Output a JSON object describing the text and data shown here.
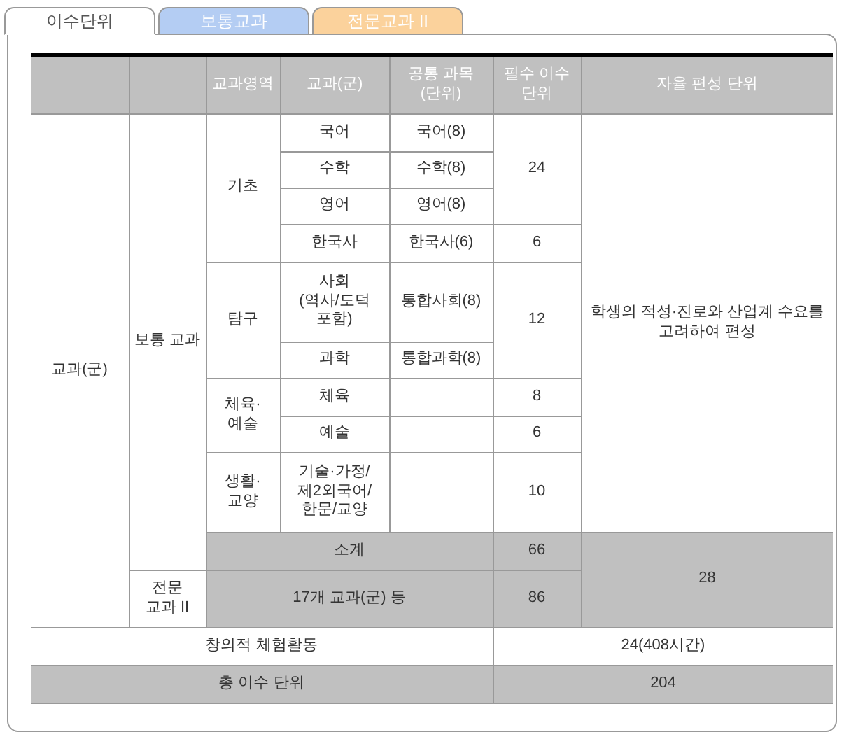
{
  "tabs": [
    {
      "label": "이수단위",
      "selected": true,
      "color": "#ffffff"
    },
    {
      "label": "보통교과",
      "selected": false,
      "color": "#b4cdf3"
    },
    {
      "label": "전문교과 II",
      "selected": false,
      "color": "#fbd29c"
    }
  ],
  "table": {
    "rows": [
      {
        "kind": "header",
        "cells": [
          {
            "shaded": true
          },
          {
            "shaded": true
          },
          {
            "text": "교과영역",
            "shaded": true
          },
          {
            "text": "교과(군)",
            "shaded": true
          },
          {
            "text": "공통 과목\n(단위)",
            "shaded": true
          },
          {
            "text": "필수 이수\n단위",
            "shaded": true
          },
          {
            "text": "자율 편성 단위",
            "shaded": true
          }
        ]
      },
      {
        "kind": "body",
        "cells": [
          {
            "text": "교과(군)",
            "rowspan": 11,
            "shaded": false
          },
          {
            "text": "보통 교과",
            "rowspan": 10,
            "shaded": false
          },
          {
            "text": "기초",
            "rowspan": 4,
            "shaded": false
          },
          {
            "text": "국어",
            "shaded": false
          },
          {
            "text": "국어(8)",
            "shaded": false
          },
          {
            "text": "24",
            "rowspan": 3,
            "shaded": false
          },
          {
            "text": "학생의 적성·진로와 산업계 수요를\n고려하여 편성",
            "rowspan": 9,
            "shaded": false
          }
        ]
      },
      {
        "kind": "body",
        "cells": [
          {
            "text": "수학",
            "shaded": false
          },
          {
            "text": "수학(8)",
            "shaded": false
          }
        ]
      },
      {
        "kind": "body",
        "cells": [
          {
            "text": "영어",
            "shaded": false
          },
          {
            "text": "영어(8)",
            "shaded": false
          }
        ]
      },
      {
        "kind": "body",
        "cells": [
          {
            "text": "한국사",
            "shaded": false
          },
          {
            "text": "한국사(6)",
            "shaded": false
          },
          {
            "text": "6",
            "shaded": false
          }
        ]
      },
      {
        "kind": "body",
        "cells": [
          {
            "text": "탐구",
            "rowspan": 2,
            "shaded": false
          },
          {
            "text": "사회\n(역사/도덕\n포함)",
            "shaded": false
          },
          {
            "text": "통합사회(8)",
            "shaded": false
          },
          {
            "text": "12",
            "rowspan": 2,
            "shaded": false
          }
        ]
      },
      {
        "kind": "body",
        "cells": [
          {
            "text": "과학",
            "shaded": false
          },
          {
            "text": "통합과학(8)",
            "shaded": false
          }
        ]
      },
      {
        "kind": "body",
        "cells": [
          {
            "text": "체육·\n예술",
            "rowspan": 2,
            "shaded": false
          },
          {
            "text": "체육",
            "shaded": false
          },
          {
            "shaded": false
          },
          {
            "text": "8",
            "shaded": false
          }
        ]
      },
      {
        "kind": "body",
        "cells": [
          {
            "text": "예술",
            "shaded": false
          },
          {
            "shaded": false
          },
          {
            "text": "6",
            "shaded": false
          }
        ]
      },
      {
        "kind": "body",
        "cells": [
          {
            "text": "생활·\n교양",
            "shaded": false
          },
          {
            "text": "기술·가정/\n제2외국어/\n한문/교양",
            "shaded": false
          },
          {
            "shaded": false
          },
          {
            "text": "10",
            "shaded": false
          }
        ]
      },
      {
        "kind": "body",
        "cells": [
          {
            "text": "소계",
            "colspan": 3,
            "shaded": true
          },
          {
            "text": "66",
            "shaded": true
          },
          {
            "text": "28",
            "rowspan": 2,
            "shaded": true
          }
        ]
      },
      {
        "kind": "body",
        "cells": [
          {
            "text": "전문\n교과 II",
            "shaded": false
          },
          {
            "text": "17개 교과(군) 등",
            "colspan": 3,
            "shaded": true
          },
          {
            "text": "86",
            "shaded": true
          }
        ]
      },
      {
        "kind": "body",
        "cells": [
          {
            "text": "창의적 체험활동",
            "colspan": 5,
            "shaded": false
          },
          {
            "text": "24(408시간)",
            "colspan": 2,
            "shaded": false
          }
        ]
      },
      {
        "kind": "body",
        "cells": [
          {
            "text": "총 이수 단위",
            "colspan": 5,
            "shaded": true
          },
          {
            "text": "204",
            "colspan": 2,
            "shaded": true
          }
        ]
      }
    ]
  }
}
